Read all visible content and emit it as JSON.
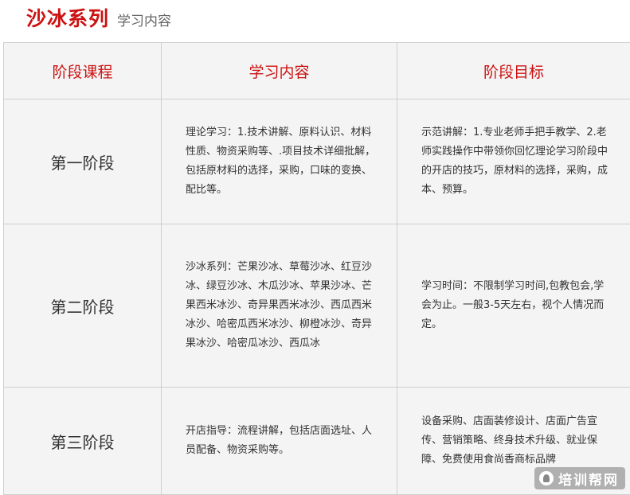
{
  "header": {
    "title": "沙冰系列",
    "subtitle": "学习内容"
  },
  "table": {
    "columns": [
      "阶段课程",
      "学习内容",
      "阶段目标"
    ],
    "rows": [
      {
        "stage": "第一阶段",
        "content": "理论学习：1.技术讲解、原料认识、材料性质、物资采购等、.项目技术详细批解，包括原材料的选择，采购，口味的变换、配比等。",
        "goal": "示范讲解：1.专业老师手把手教学、2.老师实践操作中带领你回忆理论学习阶段中的开店的技巧，原材料的选择，采购，成本、预算。"
      },
      {
        "stage": "第二阶段",
        "content": "沙冰系列：芒果沙冰、草莓沙冰、红豆沙冰、绿豆沙冰、木瓜沙冰、苹果沙冰、芒果西米冰沙、奇异果西米冰沙、西瓜西米冰沙、哈密瓜西米冰沙、柳橙冰沙、奇异果冰沙、哈密瓜冰沙、西瓜冰",
        "goal": "学习时间：不限制学习时间,包教包会,学会为止。一般3-5天左右，视个人情况而定。"
      },
      {
        "stage": "第三阶段",
        "content": "开店指导：流程讲解，包括店面选址、人员配备、物资采购等。",
        "goal": "设备采购、店面装修设计、店面广告宣传、营销策略、终身技术升级、就业保障、免费使用食尚香商标品牌"
      }
    ]
  },
  "watermark": {
    "text": "培训帮网",
    "icon": "logo-icon"
  }
}
